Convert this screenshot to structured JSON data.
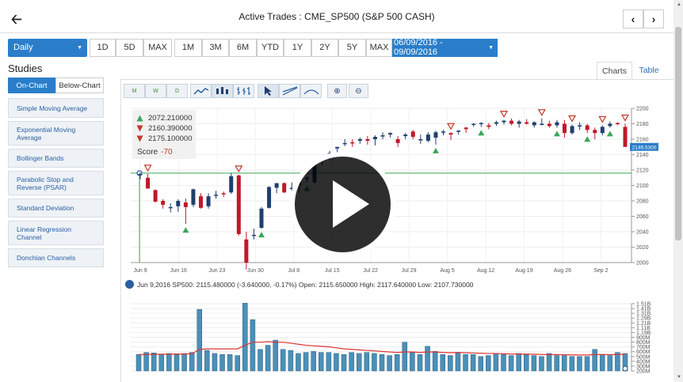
{
  "header": {
    "title": "Active Trades : CME_SP500 (S&P 500 CASH)"
  },
  "toolbar": {
    "period_select": "Daily",
    "ranges_a": [
      "1D",
      "5D",
      "MAX"
    ],
    "ranges_b": [
      "1M",
      "3M",
      "6M",
      "YTD",
      "1Y",
      "2Y",
      "5Y",
      "MAX"
    ],
    "date_range": "06/09/2016 - 09/09/2016"
  },
  "studies": {
    "title": "Studies",
    "on_chart": "On-Chart",
    "below_chart": "Below-Chart",
    "items": [
      "Simple Moving Average",
      "Exponential Moving Average",
      "Bollinger Bands",
      "Parabolic Stop and Reverse (PSAR)",
      "Standard Deviation",
      "Linear Regression Channel",
      "Donchian Channels"
    ]
  },
  "tabs": [
    "Charts",
    "Table"
  ],
  "legend": {
    "rows": [
      {
        "icon": "up-signal-icon",
        "value": "2072.210000"
      },
      {
        "icon": "down-signal-icon",
        "value": "2160.390000"
      },
      {
        "icon": "down-signal-icon",
        "value": "2175.100000"
      }
    ],
    "score_label": "Score",
    "score_value": "-70"
  },
  "info_line": "Jun 9,2016 SP500: 2115.480000 (-3.640000, -0.17%) Open: 2115.650000 High: 2117.640000 Low: 2107.730000",
  "colors": {
    "up": "#1f3f6e",
    "down": "#c0182a",
    "accent": "#2a7ec9",
    "volume": "#4a90b8",
    "ma": "#d33"
  },
  "chart_data": [
    {
      "type": "candlestick",
      "x_ticks": [
        "Jun 9",
        "Jun 16",
        "Jun 23",
        "Jun 30",
        "Jul 8",
        "Jul 15",
        "Jul 22",
        "Jul 29",
        "Aug 5",
        "Aug 12",
        "Aug 19",
        "Aug 26",
        "Sep 2"
      ],
      "y_ticks": [
        "2200",
        "2180",
        "2160",
        "2140",
        "2120",
        "2100",
        "2080",
        "2060",
        "2040",
        "2020",
        "2000"
      ],
      "ylim": [
        2000,
        2200
      ],
      "last_price_label": "2149.5300",
      "reference_line": 2116,
      "candles": [
        [
          2115,
          2117,
          2108,
          2115
        ],
        [
          2110,
          2115,
          2096,
          2096
        ],
        [
          2094,
          2095,
          2078,
          2079
        ],
        [
          2080,
          2082,
          2070,
          2075
        ],
        [
          2072,
          2077,
          2065,
          2072
        ],
        [
          2073,
          2082,
          2066,
          2080
        ],
        [
          2078,
          2083,
          2050,
          2072
        ],
        [
          2075,
          2096,
          2072,
          2095
        ],
        [
          2086,
          2090,
          2070,
          2071
        ],
        [
          2073,
          2090,
          2070,
          2086
        ],
        [
          2087,
          2093,
          2083,
          2088
        ],
        [
          2090,
          2092,
          2085,
          2089
        ],
        [
          2091,
          2116,
          2089,
          2112
        ],
        [
          2113,
          2114,
          2035,
          2037
        ],
        [
          2030,
          2040,
          1991,
          2000
        ],
        [
          2036,
          2044,
          2030,
          2036
        ],
        [
          2045,
          2072,
          2044,
          2070
        ],
        [
          2071,
          2099,
          2070,
          2098
        ],
        [
          2097,
          2103,
          2090,
          2103
        ],
        [
          2103,
          2104,
          2090,
          2091
        ],
        [
          2097,
          2104,
          2093,
          2097
        ],
        [
          2100,
          2107,
          2090,
          2104
        ],
        [
          2110,
          2112,
          2104,
          2110
        ],
        [
          2104,
          2130,
          2102,
          2129
        ],
        [
          2132,
          2137,
          2126,
          2137
        ],
        [
          2140,
          2145,
          2133,
          2142
        ],
        [
          2148,
          2150,
          2140,
          2150
        ],
        [
          2155,
          2160,
          2151,
          2155
        ],
        [
          2156,
          2160,
          2150,
          2155
        ],
        [
          2158,
          2162,
          2154,
          2160
        ],
        [
          2160,
          2164,
          2153,
          2158
        ],
        [
          2160,
          2165,
          2152,
          2163
        ],
        [
          2165,
          2169,
          2160,
          2165
        ],
        [
          2166,
          2169,
          2162,
          2168
        ],
        [
          2160,
          2164,
          2150,
          2155
        ],
        [
          2164,
          2168,
          2160,
          2166
        ],
        [
          2170,
          2172,
          2160,
          2163
        ],
        [
          2160,
          2166,
          2154,
          2160
        ],
        [
          2158,
          2169,
          2156,
          2166
        ],
        [
          2162,
          2171,
          2153,
          2169
        ],
        [
          2169,
          2172,
          2165,
          2170
        ],
        [
          2168,
          2169,
          2159,
          2166
        ],
        [
          2170,
          2172,
          2166,
          2171
        ],
        [
          2175,
          2176,
          2168,
          2173
        ],
        [
          2179,
          2181,
          2176,
          2180
        ],
        [
          2180,
          2182,
          2176,
          2181
        ],
        [
          2178,
          2181,
          2173,
          2176
        ],
        [
          2180,
          2184,
          2177,
          2182
        ],
        [
          2182,
          2185,
          2179,
          2184
        ],
        [
          2184,
          2187,
          2178,
          2180
        ],
        [
          2180,
          2185,
          2175,
          2183
        ],
        [
          2182,
          2186,
          2179,
          2180
        ],
        [
          2178,
          2183,
          2175,
          2182
        ],
        [
          2180,
          2187,
          2178,
          2180
        ],
        [
          2180,
          2184,
          2175,
          2177
        ],
        [
          2178,
          2185,
          2175,
          2182
        ],
        [
          2180,
          2185,
          2162,
          2168
        ],
        [
          2168,
          2179,
          2166,
          2177
        ],
        [
          2177,
          2182,
          2172,
          2178
        ],
        [
          2178,
          2180,
          2168,
          2172
        ],
        [
          2172,
          2175,
          2160,
          2168
        ],
        [
          2168,
          2178,
          2165,
          2176
        ],
        [
          2177,
          2183,
          2175,
          2180
        ],
        [
          2181,
          2182,
          2178,
          2180
        ],
        [
          2176,
          2180,
          2150,
          2150
        ]
      ],
      "signals": [
        {
          "index": 1,
          "type": "down"
        },
        {
          "index": 6,
          "type": "up"
        },
        {
          "index": 13,
          "type": "down"
        },
        {
          "index": 16,
          "type": "up"
        },
        {
          "index": 22,
          "type": "up"
        },
        {
          "index": 39,
          "type": "up"
        },
        {
          "index": 41,
          "type": "down"
        },
        {
          "index": 45,
          "type": "up"
        },
        {
          "index": 48,
          "type": "down"
        },
        {
          "index": 53,
          "type": "down"
        },
        {
          "index": 55,
          "type": "up"
        },
        {
          "index": 57,
          "type": "down"
        },
        {
          "index": 59,
          "type": "up"
        },
        {
          "index": 61,
          "type": "down"
        },
        {
          "index": 62,
          "type": "up"
        },
        {
          "index": 64,
          "type": "down"
        }
      ]
    },
    {
      "type": "bar",
      "y_ticks": [
        "1.51B",
        "1.41B",
        "1.31B",
        "1.29B",
        "1.21B",
        "1.11B",
        "1.19B",
        "900M",
        "800M",
        "700M",
        "600M",
        "500M",
        "400M",
        "300M",
        "200M"
      ],
      "ylim": [
        200,
        1510
      ],
      "values": [
        520,
        560,
        550,
        520,
        540,
        520,
        540,
        560,
        1400,
        600,
        540,
        520,
        520,
        500,
        1520,
        1200,
        620,
        700,
        800,
        620,
        600,
        540,
        560,
        580,
        560,
        560,
        540,
        520,
        560,
        540,
        560,
        540,
        520,
        500,
        520,
        760,
        560,
        520,
        680,
        580,
        520,
        500,
        560,
        520,
        520,
        480,
        500,
        540,
        520,
        500,
        540,
        520,
        500,
        480,
        540,
        500,
        500,
        480,
        480,
        480,
        620,
        520,
        500,
        560,
        540
      ],
      "moving_average": [
        520,
        520,
        525,
        525,
        528,
        530,
        530,
        535,
        620,
        630,
        630,
        630,
        630,
        630,
        700,
        760,
        760,
        770,
        760,
        760,
        740,
        720,
        700,
        690,
        680,
        670,
        650,
        630,
        620,
        610,
        600,
        590,
        580,
        570,
        560,
        570,
        570,
        560,
        570,
        570,
        560,
        555,
        560,
        555,
        550,
        545,
        540,
        540,
        535,
        530,
        530,
        528,
        525,
        520,
        520,
        518,
        515,
        512,
        510,
        510,
        520,
        520,
        518,
        520,
        525
      ]
    }
  ]
}
